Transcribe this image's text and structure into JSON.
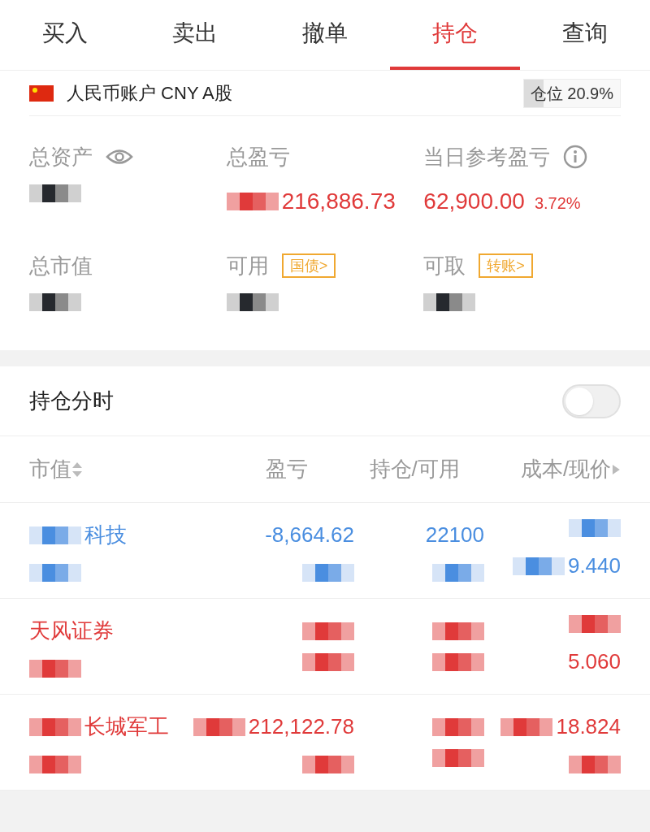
{
  "tabs": [
    {
      "label": "买入",
      "selected": false
    },
    {
      "label": "卖出",
      "selected": false
    },
    {
      "label": "撤单",
      "selected": false
    },
    {
      "label": "持仓",
      "selected": true
    },
    {
      "label": "查询",
      "selected": false
    }
  ],
  "account": {
    "name": "人民币账户 CNY A股",
    "position_label": "仓位 20.9%",
    "level": 0.209
  },
  "summary": [
    {
      "label": "总资产",
      "value": {
        "redacted": true
      },
      "kind": "plain"
    },
    {
      "label": "总盈亏",
      "value": {
        "text": "216,886.73",
        "redacted": true
      },
      "kind": "gain"
    },
    {
      "label": "当日参考盈亏",
      "value": {
        "text": "62,900.00",
        "redacted": false
      },
      "extra": "3.72%",
      "kind": "gain"
    },
    {
      "label": "总市值",
      "value": {
        "redacted": true
      },
      "kind": "plain"
    },
    {
      "label": "可用",
      "value": {
        "redacted": true
      },
      "tag": "国债>",
      "kind": "plain"
    },
    {
      "label": "可取",
      "value": {
        "redacted": true
      },
      "tag": "转账>",
      "kind": "plain"
    }
  ],
  "chart_toggle": {
    "label": "持仓分时",
    "on": false
  },
  "columns": [
    "市值",
    "盈亏",
    "持仓/可用",
    "成本/现价"
  ],
  "rows": [
    {
      "kind": "loss",
      "cells": [
        [
          {
            "text": "科技",
            "redacted": true
          },
          {
            "redacted": true
          }
        ],
        [
          {
            "text": "-8,664.62",
            "redacted": false
          },
          {
            "redacted": true
          }
        ],
        [
          {
            "text": "22100",
            "redacted": false
          },
          {
            "redacted": true
          }
        ],
        [
          {
            "redacted": true
          },
          {
            "text": "9.440",
            "redacted": true
          }
        ]
      ]
    },
    {
      "kind": "gain",
      "cells": [
        [
          {
            "text": "天风证券",
            "redacted": false
          },
          {
            "redacted": true
          }
        ],
        [
          {
            "redacted": true
          },
          {
            "redacted": true
          }
        ],
        [
          {
            "redacted": true
          },
          {
            "redacted": true
          }
        ],
        [
          {
            "redacted": true
          },
          {
            "text": "5.060",
            "redacted": false
          }
        ]
      ]
    },
    {
      "kind": "gain",
      "cells": [
        [
          {
            "text": "长城军工",
            "redacted": true
          },
          {
            "redacted": true
          }
        ],
        [
          {
            "text": "212,122.78",
            "redacted": true
          },
          {
            "redacted": true
          }
        ],
        [
          {
            "redacted": true
          },
          {
            "redacted": true
          }
        ],
        [
          {
            "text": "18.824",
            "redacted": true
          },
          {
            "redacted": true
          }
        ]
      ]
    }
  ]
}
